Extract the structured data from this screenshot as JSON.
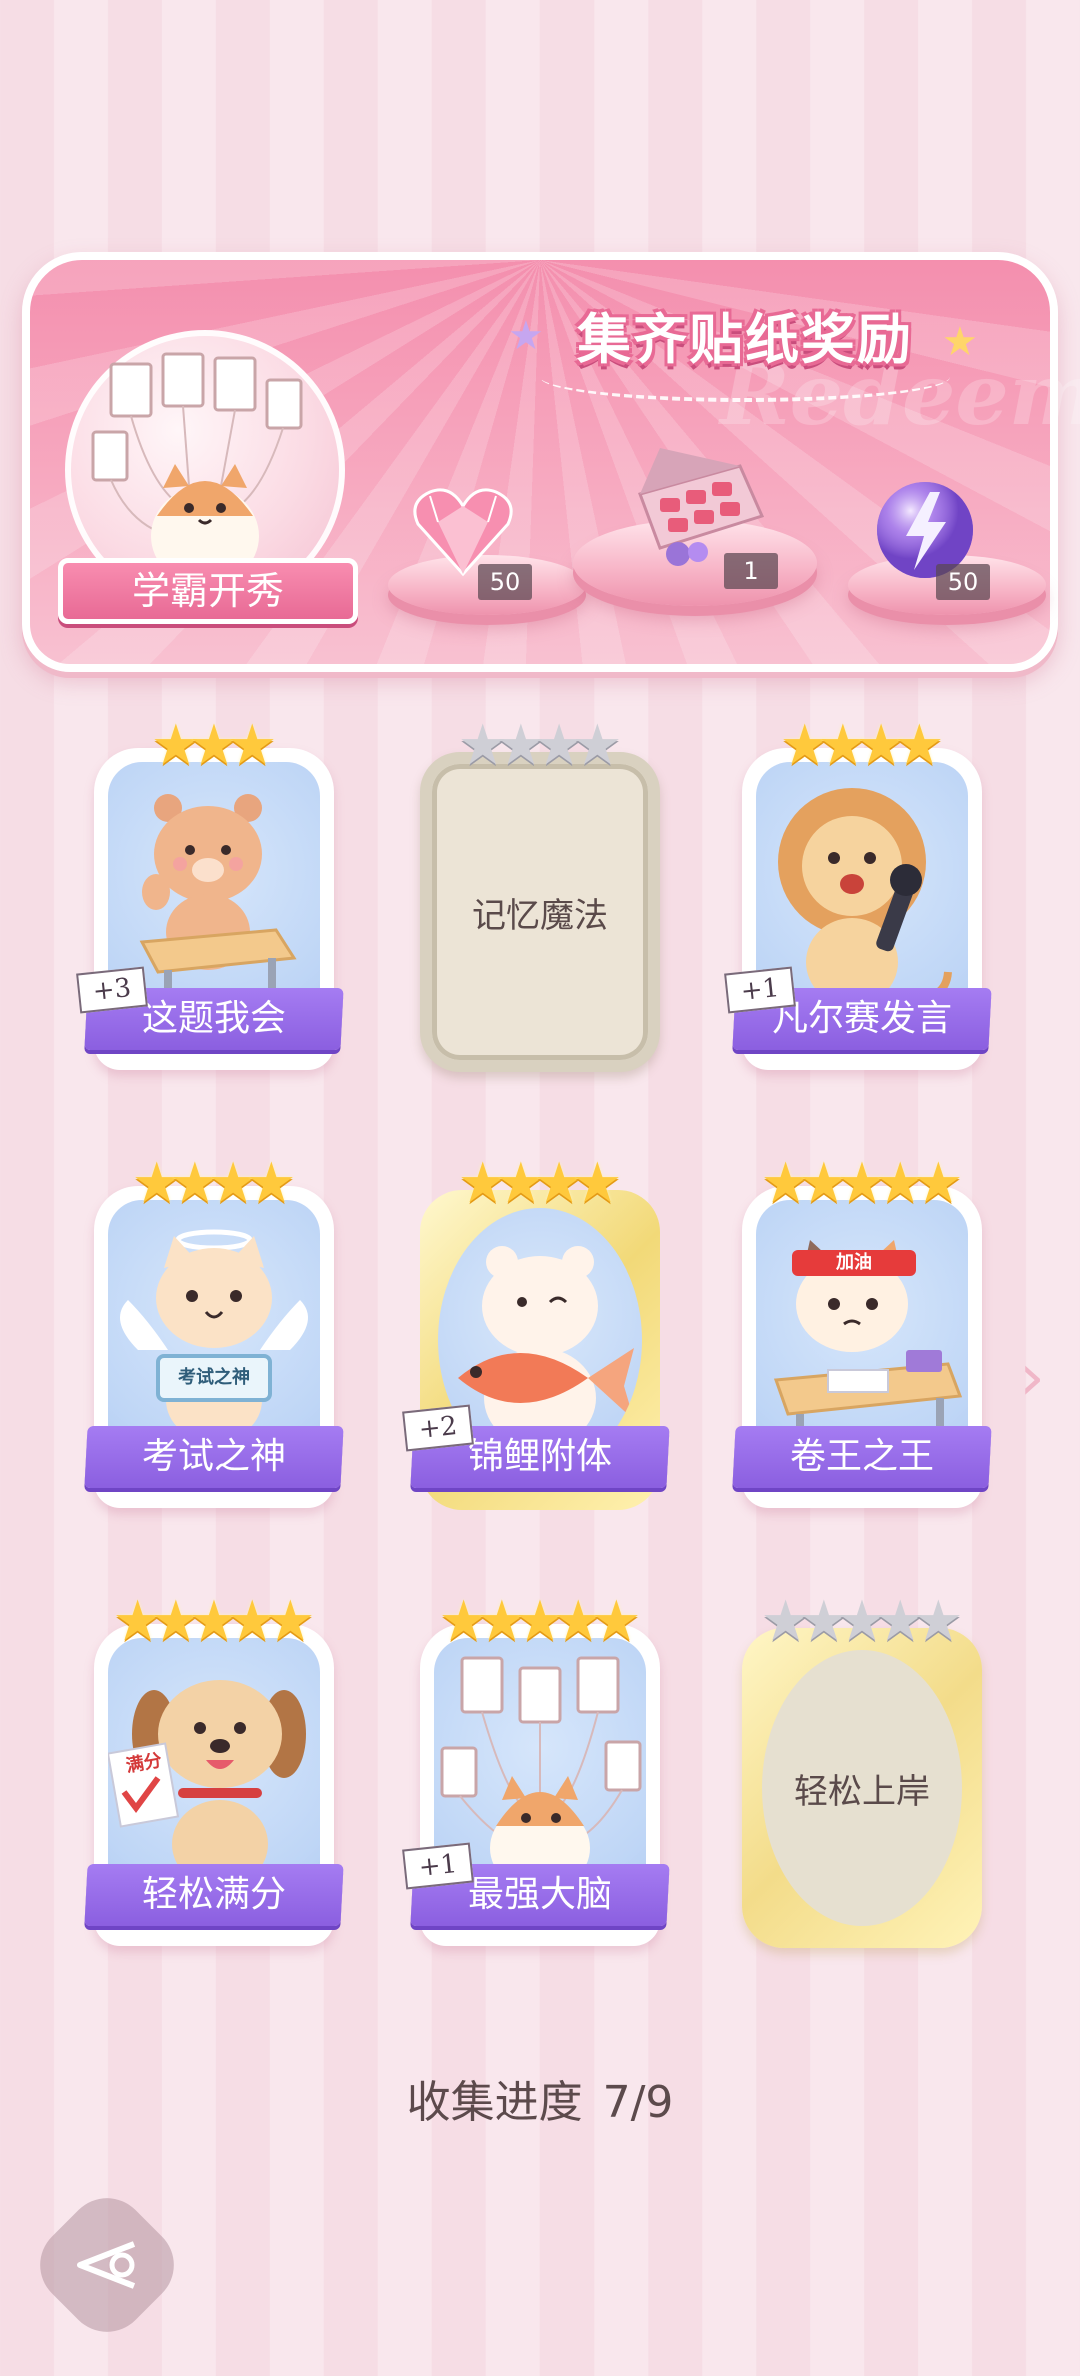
{
  "banner": {
    "title": "集齐贴纸奖励",
    "watermark": "Redeem",
    "scholar_label": "学霸开秀",
    "rewards": [
      {
        "icon": "pink-heart-gem-icon",
        "count": "50"
      },
      {
        "icon": "gift-box-icon",
        "count": "1"
      },
      {
        "icon": "lightning-orb-icon",
        "count": "50"
      }
    ]
  },
  "cards": [
    {
      "name": "这题我会",
      "stars_filled": 3,
      "stars_total": 3,
      "bonus": "+3",
      "unlocked": true,
      "art": "bear-at-desk-icon"
    },
    {
      "name": "记忆魔法",
      "stars_filled": 0,
      "stars_total": 4,
      "bonus": "",
      "unlocked": false,
      "art": "locked-parchment"
    },
    {
      "name": "凡尔赛发言",
      "stars_filled": 4,
      "stars_total": 4,
      "bonus": "+1",
      "unlocked": true,
      "art": "lion-microphone-icon"
    },
    {
      "name": "考试之神",
      "stars_filled": 4,
      "stars_total": 4,
      "bonus": "",
      "unlocked": true,
      "art": "angel-cat-icon",
      "sign_text": "考试之神"
    },
    {
      "name": "锦鲤附体",
      "stars_filled": 4,
      "stars_total": 4,
      "bonus": "+2",
      "unlocked": true,
      "art": "bear-with-koi-icon"
    },
    {
      "name": "卷王之王",
      "stars_filled": 5,
      "stars_total": 5,
      "bonus": "",
      "unlocked": true,
      "art": "studying-cat-icon",
      "headband_text": "加油"
    },
    {
      "name": "轻松满分",
      "stars_filled": 5,
      "stars_total": 5,
      "bonus": "",
      "unlocked": true,
      "art": "puppy-full-marks-icon",
      "paper_text": "满分"
    },
    {
      "name": "最强大脑",
      "stars_filled": 5,
      "stars_total": 5,
      "bonus": "+1",
      "unlocked": true,
      "art": "cat-with-papers-icon"
    },
    {
      "name": "轻松上岸",
      "stars_filled": 0,
      "stars_total": 5,
      "bonus": "",
      "unlocked": false,
      "art": "locked-gold-oval"
    }
  ],
  "progress": {
    "label": "收集进度",
    "value": "7/9"
  },
  "colors": {
    "ribbon": "#8b5fe0",
    "banner_pink": "#f48fae",
    "star_gold": "#ffc93c",
    "star_grey": "#cfcfd6"
  }
}
